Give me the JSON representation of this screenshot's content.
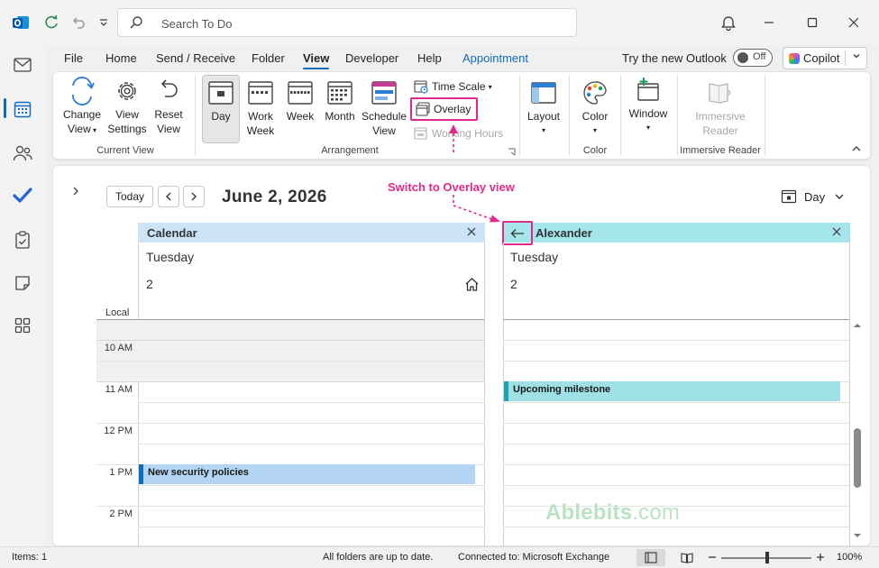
{
  "titlebar": {
    "search_placeholder": "Search To Do"
  },
  "menu": [
    {
      "label": "File"
    },
    {
      "label": "Home"
    },
    {
      "label": "Send / Receive"
    },
    {
      "label": "Folder"
    },
    {
      "label": "View",
      "active": true
    },
    {
      "label": "Developer"
    },
    {
      "label": "Help"
    },
    {
      "label": "Appointment",
      "contextual": true
    }
  ],
  "header_right": {
    "try_new": "Try the new Outlook",
    "toggle_label": "Off",
    "copilot": "Copilot"
  },
  "ribbon": {
    "current_view": {
      "group_label": "Current View",
      "change_view": [
        "Change",
        "View"
      ],
      "view_settings": [
        "View",
        "Settings"
      ],
      "reset_view": [
        "Reset",
        "View"
      ]
    },
    "arrangement": {
      "group_label": "Arrangement",
      "day": "Day",
      "work_week": [
        "Work",
        "Week"
      ],
      "week": "Week",
      "month": "Month",
      "schedule_view": [
        "Schedule",
        "View"
      ],
      "time_scale": "Time Scale",
      "overlay": "Overlay",
      "working_hours": "Working Hours"
    },
    "layout": {
      "label": "Layout"
    },
    "color": {
      "label": "Color",
      "group_label": "Color"
    },
    "window": {
      "label": "Window"
    },
    "immersive": {
      "label": [
        "Immersive",
        "Reader"
      ],
      "group_label": "Immersive Reader"
    }
  },
  "calendar_header": {
    "today": "Today",
    "date": "June 2, 2026",
    "annotation": "Switch to Overlay view",
    "view_mode": "Day"
  },
  "panes": [
    {
      "name": "Calendar",
      "day_name": "Tuesday",
      "day_number": "2",
      "color": "#cce4f7"
    },
    {
      "name": "Alexander",
      "day_name": "Tuesday",
      "day_number": "2",
      "color": "#a5e6ec"
    }
  ],
  "timezone_label": "Local",
  "times": [
    "10 AM",
    "11 AM",
    "12 PM",
    "1 PM",
    "2 PM"
  ],
  "events": [
    {
      "title": "New security policies",
      "pane": 0,
      "time": "1 PM"
    },
    {
      "title": "Upcoming milestone",
      "pane": 1,
      "time": "11 AM"
    }
  ],
  "watermark": {
    "main": "Ablebits",
    "suffix": ".com"
  },
  "status": {
    "items": "Items: 1",
    "sync": "All folders are up to date.",
    "connection": "Connected to: Microsoft Exchange",
    "zoom": "100%"
  }
}
